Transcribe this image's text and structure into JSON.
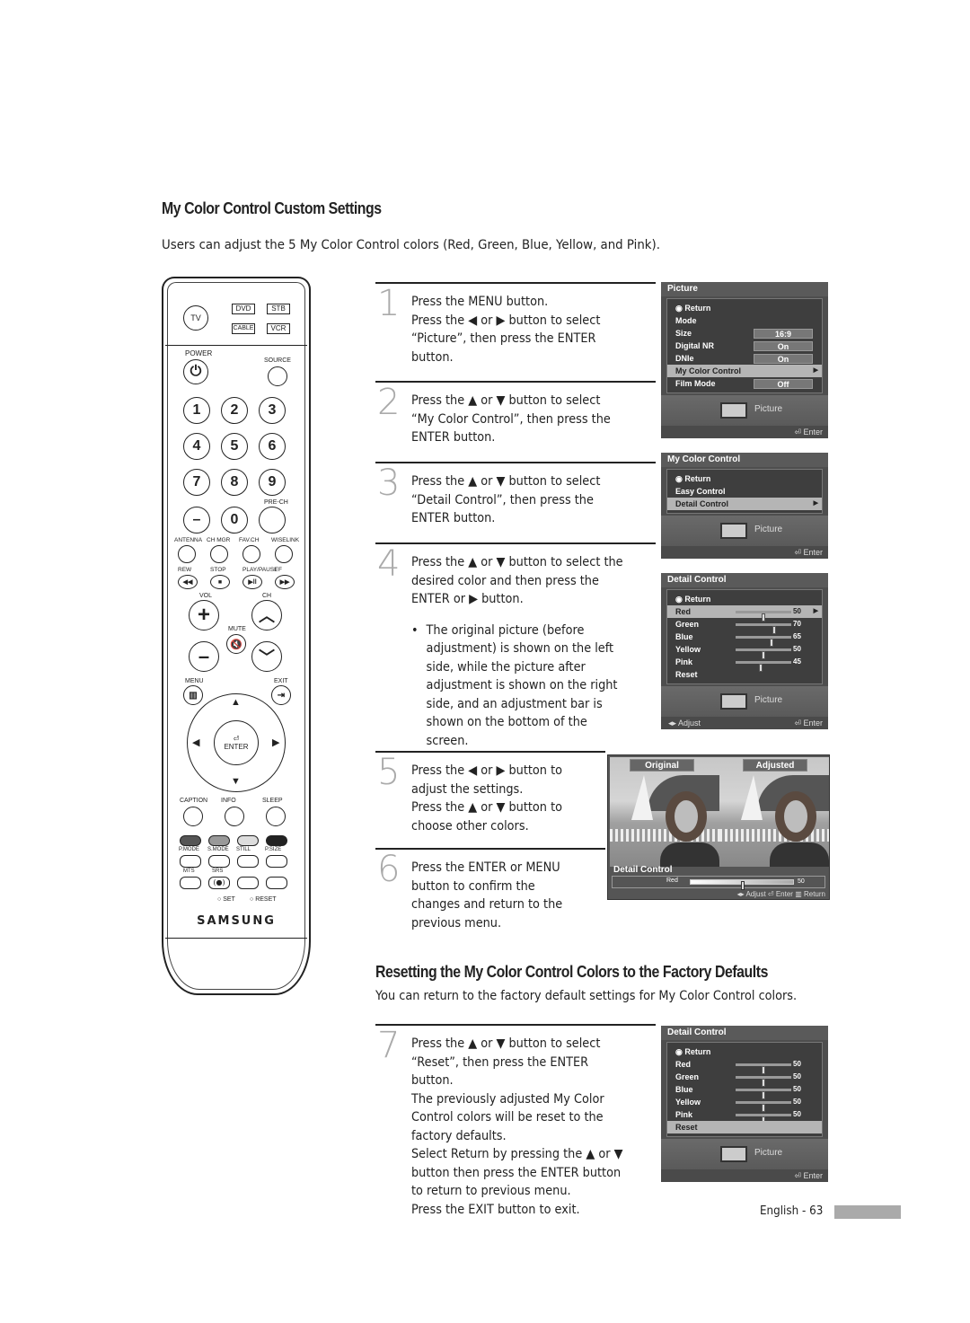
{
  "section1": {
    "title": "My Color Control Custom Settings",
    "intro": "Users can adjust the 5 My Color Control colors (Red, Green, Blue, Yellow, and Pink)."
  },
  "steps": [
    {
      "num": "1",
      "lines": [
        "Press the MENU button.",
        "Press the ◀ or ▶ button to select",
        "“Picture”, then press  the ENTER",
        "button."
      ]
    },
    {
      "num": "2",
      "lines": [
        "Press the ▲ or ▼ button to select",
        "“My Color Control”, then press the",
        "ENTER button."
      ]
    },
    {
      "num": "3",
      "lines": [
        "Press the ▲ or ▼ button to select",
        "“Detail Control”, then press the",
        "ENTER button."
      ]
    },
    {
      "num": "4",
      "lines": [
        "Press the ▲ or ▼ button to select the",
        "desired color and then press the",
        "ENTER or ▶ button."
      ],
      "bullet": [
        "The original picture (before",
        "adjustment) is shown on the left",
        "side, while the picture after",
        "adjustment is shown on the right",
        "side, and an adjustment bar is",
        "shown on the bottom of the",
        "screen."
      ]
    },
    {
      "num": "5",
      "lines": [
        "Press the ◀ or ▶ button to",
        "adjust the settings.",
        "Press the ▲ or ▼ button to",
        "choose other colors."
      ]
    },
    {
      "num": "6",
      "lines": [
        "Press the ENTER or MENU",
        "button to confirm the",
        "changes and return to the",
        "previous menu."
      ]
    },
    {
      "num": "7",
      "lines": [
        "Press the ▲ or ▼ button to select",
        "“Reset”, then press the ENTER",
        "button.",
        "The previously adjusted My Color",
        "Control colors will be reset to the",
        "factory defaults.",
        "Select Return by pressing the ▲ or ▼",
        "button then press the ENTER button",
        "to return to previous menu.",
        "Press the EXIT button to exit."
      ]
    }
  ],
  "section2": {
    "title": "Resetting the My Color Control Colors to the Factory Defaults",
    "intro": "You can return to the factory default settings for My Color Control colors."
  },
  "osd_picture": {
    "title": "Picture",
    "items": [
      {
        "label": "Return",
        "value": null,
        "selected": false
      },
      {
        "label": "Mode",
        "value": null,
        "selected": false
      },
      {
        "label": "Size",
        "value": "16:9",
        "selected": false
      },
      {
        "label": "Digital NR",
        "value": "On",
        "selected": false
      },
      {
        "label": "DNIe",
        "value": "On",
        "selected": false
      },
      {
        "label": "My Color Control",
        "value": null,
        "selected": true
      },
      {
        "label": "Film Mode",
        "value": "Off",
        "selected": false
      }
    ],
    "footer_label": "Picture",
    "enter": "Enter"
  },
  "osd_mycolor": {
    "title": "My Color Control",
    "items": [
      {
        "label": "Return",
        "selected": false
      },
      {
        "label": "Easy Control",
        "selected": false
      },
      {
        "label": "Detail Control",
        "selected": true
      }
    ],
    "footer_label": "Picture",
    "enter": "Enter"
  },
  "osd_detail": {
    "title": "Detail Control",
    "return": "Return",
    "colors": [
      {
        "label": "Red",
        "value": 50,
        "selected": true
      },
      {
        "label": "Green",
        "value": 70,
        "selected": false
      },
      {
        "label": "Blue",
        "value": 65,
        "selected": false
      },
      {
        "label": "Yellow",
        "value": 50,
        "selected": false
      },
      {
        "label": "Pink",
        "value": 45,
        "selected": false
      }
    ],
    "reset": "Reset",
    "footer_label": "Picture",
    "adjust": "Adjust",
    "enter": "Enter"
  },
  "compare": {
    "original": "Original",
    "adjusted": "Adjusted",
    "title": "Detail Control",
    "color": "Red",
    "value": 50,
    "adjust": "Adjust",
    "enter": "Enter",
    "return": "Return"
  },
  "osd_reset": {
    "title": "Detail Control",
    "return": "Return",
    "colors": [
      {
        "label": "Red",
        "value": 50
      },
      {
        "label": "Green",
        "value": 50
      },
      {
        "label": "Blue",
        "value": 50
      },
      {
        "label": "Yellow",
        "value": 50
      },
      {
        "label": "Pink",
        "value": 50
      }
    ],
    "reset": "Reset",
    "footer_label": "Picture",
    "enter": "Enter"
  },
  "remote": {
    "tv": "TV",
    "dvd": "DVD",
    "stb": "STB",
    "cable": "CABLE",
    "vcr": "VCR",
    "power": "POWER",
    "source": "SOURCE",
    "digits": [
      "1",
      "2",
      "3",
      "4",
      "5",
      "6",
      "7",
      "8",
      "9",
      "–",
      "0",
      ""
    ],
    "prech": "PRE-CH",
    "row_labels": [
      "ANTENNA",
      "CH MGR",
      "FAV.CH",
      "WISELINK"
    ],
    "transport": [
      "REW",
      "STOP",
      "PLAY/PAUSE",
      "FF"
    ],
    "vol": "VOL",
    "ch": "CH",
    "mute": "MUTE",
    "menu": "MENU",
    "exit": "EXIT",
    "enter": "ENTER",
    "func": [
      "CAPTION",
      "INFO",
      "SLEEP"
    ],
    "mode": [
      "P.MODE",
      "S.MODE",
      "STILL",
      "P.SIZE"
    ],
    "mts": "MTS",
    "srs": "SRS",
    "set": "SET",
    "reset": "RESET",
    "brand": "SAMSUNG"
  },
  "page": {
    "footer": "English - 63"
  }
}
